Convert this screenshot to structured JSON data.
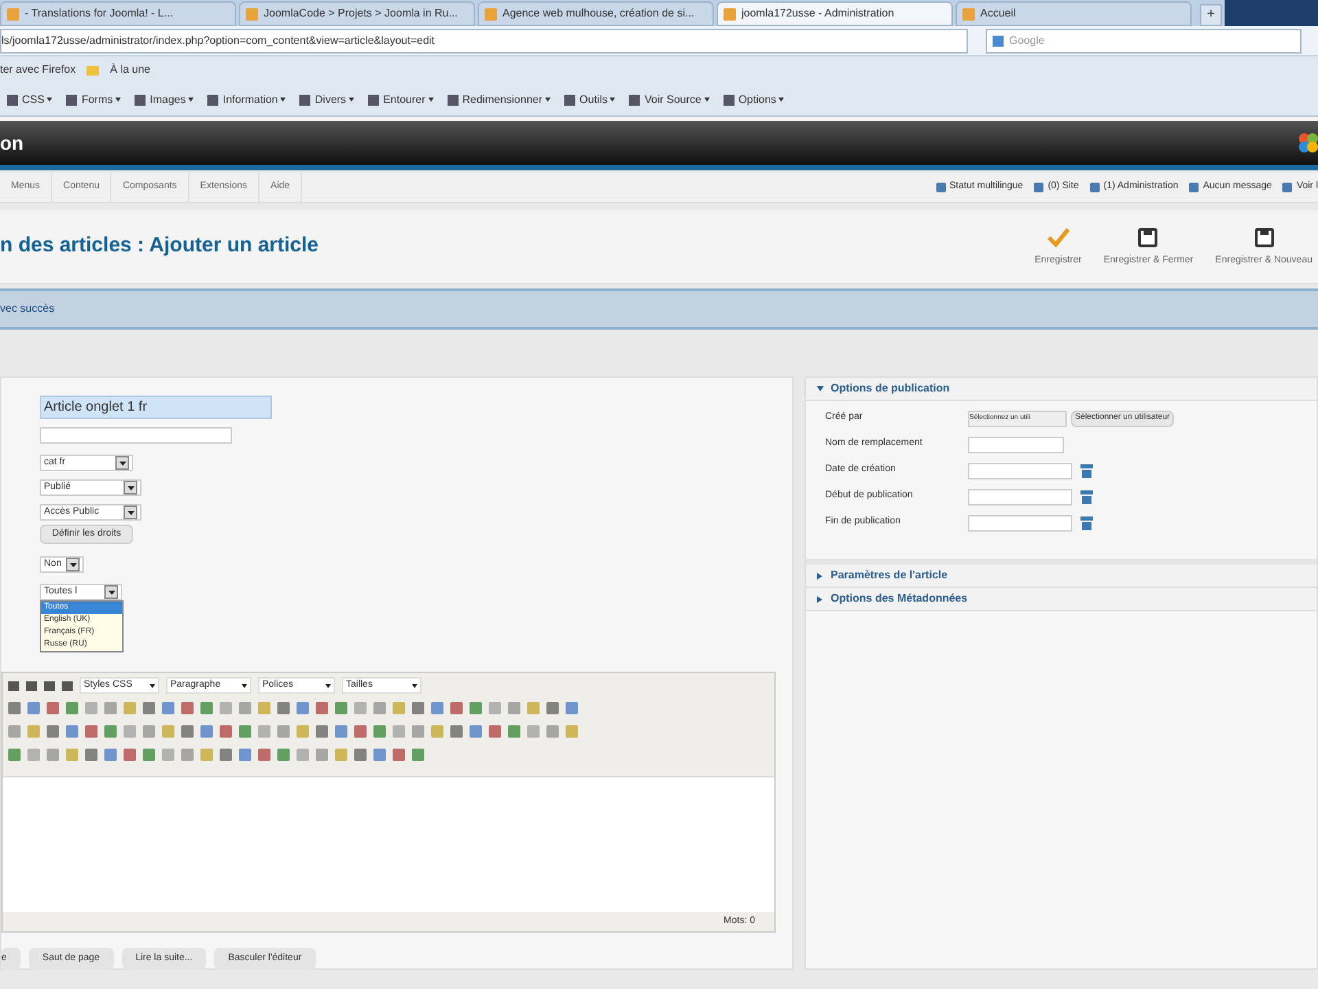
{
  "browser": {
    "tabs": [
      {
        "label": "- Translations for Joomla! - L...",
        "selected": false
      },
      {
        "label": "JoomlaCode > Projets > Joomla in Ru...",
        "selected": false
      },
      {
        "label": "Agence web mulhouse, création de si...",
        "selected": false
      },
      {
        "label": "joomla172usse - Administration",
        "selected": true
      },
      {
        "label": "Accueil",
        "selected": false
      }
    ],
    "new_tab": "+",
    "url": "ls/joomla172usse/administrator/index.php?option=com_content&view=article&layout=edit",
    "search_placeholder": "Google",
    "bookmarks": [
      "ter avec Firefox",
      "À la une"
    ],
    "dev_toolbar": [
      "CSS",
      "Forms",
      "Images",
      "Information",
      "Divers",
      "Entourer",
      "Redimensionner",
      "Outils",
      "Voir Source",
      "Options"
    ]
  },
  "header": {
    "title": "on"
  },
  "menu": {
    "items": [
      "Menus",
      "Contenu",
      "Composants",
      "Extensions",
      "Aide"
    ],
    "status": [
      "Statut multilingue",
      "(0) Site",
      "(1) Administration",
      "Aucun message",
      "Voir l"
    ]
  },
  "page_title": "n des articles : Ajouter un article",
  "toolbar": [
    {
      "label": "Enregistrer",
      "kind": "check"
    },
    {
      "label": "Enregistrer & Fermer",
      "kind": "save"
    },
    {
      "label": "Enregistrer & Nouveau",
      "kind": "save"
    }
  ],
  "message": "vec succès",
  "form": {
    "title_value": "Article onglet 1 fr",
    "category": "cat fr",
    "status": "Publié",
    "access": "Accès Public",
    "permissions_button": "Définir les droits",
    "featured": "Non",
    "language": {
      "value": "Toutes l",
      "expanded": true,
      "options": [
        {
          "label": "Toutes",
          "selected": true
        },
        {
          "label": "English (UK)",
          "selected": false
        },
        {
          "label": "Français (FR)",
          "selected": false
        },
        {
          "label": "Russe (RU)",
          "selected": false
        }
      ]
    }
  },
  "editor": {
    "selects": [
      "Styles CSS",
      "Paragraphe",
      "Polices",
      "Tailles"
    ],
    "word_count": "Mots: 0",
    "buttons": [
      "e",
      "Saut de page",
      "Lire la suite...",
      "Basculer l'éditeur"
    ]
  },
  "sidebar": {
    "sections": [
      {
        "title": "Options de publication",
        "expanded": true,
        "fields": [
          {
            "label": "Créé par",
            "kind": "user",
            "value": "Sélectionnez un utili",
            "button": "Sélectionner un utilisateur"
          },
          {
            "label": "Nom de remplacement",
            "kind": "text"
          },
          {
            "label": "Date de création",
            "kind": "date"
          },
          {
            "label": "Début de publication",
            "kind": "date"
          },
          {
            "label": "Fin de publication",
            "kind": "date"
          }
        ]
      },
      {
        "title": "Paramètres de l'article",
        "expanded": false
      },
      {
        "title": "Options des Métadonnées",
        "expanded": false
      }
    ]
  }
}
